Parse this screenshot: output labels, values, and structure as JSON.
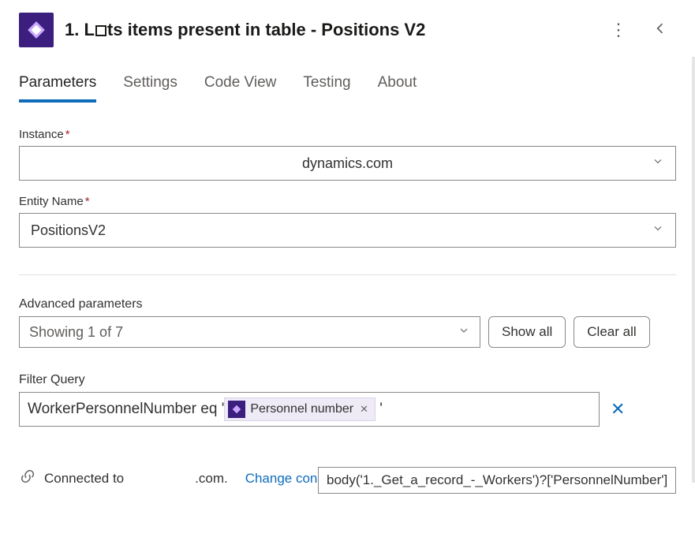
{
  "header": {
    "title_prefix": "1. L",
    "title_suffix": "ts items present in table - Positions V2"
  },
  "tabs": [
    {
      "label": "Parameters",
      "active": true
    },
    {
      "label": "Settings",
      "active": false
    },
    {
      "label": "Code View",
      "active": false
    },
    {
      "label": "Testing",
      "active": false
    },
    {
      "label": "About",
      "active": false
    }
  ],
  "fields": {
    "instance": {
      "label": "Instance",
      "required": true,
      "value": "dynamics.com"
    },
    "entity": {
      "label": "Entity Name",
      "required": true,
      "value": "PositionsV2"
    }
  },
  "advanced": {
    "label": "Advanced parameters",
    "summary": "Showing 1 of 7",
    "show_all": "Show all",
    "clear_all": "Clear all"
  },
  "filter": {
    "label": "Filter Query",
    "prefix_text": "WorkerPersonnelNumber eq '",
    "token_label": "Personnel number",
    "suffix_text": " '",
    "tooltip": "body('1._Get_a_record_-_Workers')?['PersonnelNumber']"
  },
  "connection": {
    "label": "Connected to",
    "domain_suffix": ".com.",
    "change_label": "Change connection"
  }
}
